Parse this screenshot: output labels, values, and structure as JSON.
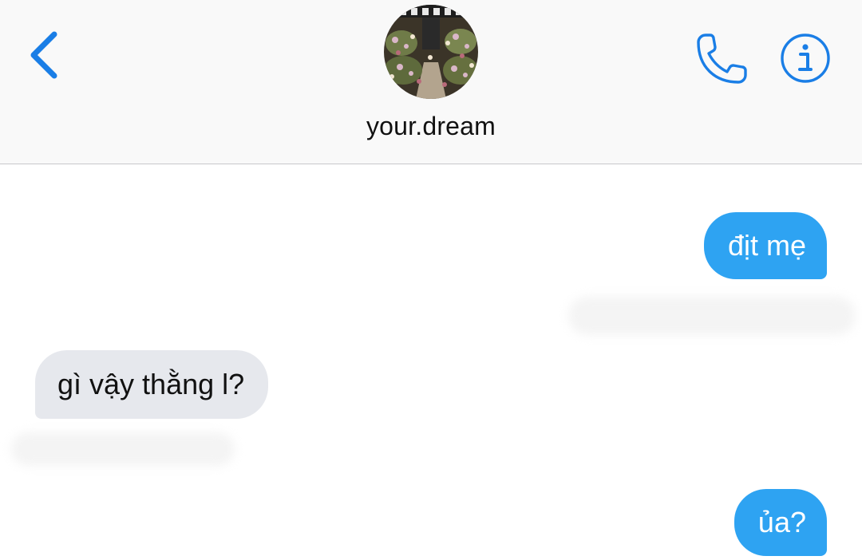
{
  "header": {
    "contact_name": "your.dream",
    "accent_color": "#1a7ee6"
  },
  "icons": {
    "back": "chevron-left-icon",
    "call": "phone-icon",
    "info": "info-icon"
  },
  "messages": [
    {
      "direction": "sent",
      "text": "địt mẹ",
      "bubble_color": "#2ea3f2"
    },
    {
      "direction": "received",
      "text": "gì vậy thằng l?",
      "bubble_color": "#e6e8ed"
    },
    {
      "direction": "sent",
      "text": "ủa?",
      "bubble_color": "#2ea3f2"
    }
  ]
}
